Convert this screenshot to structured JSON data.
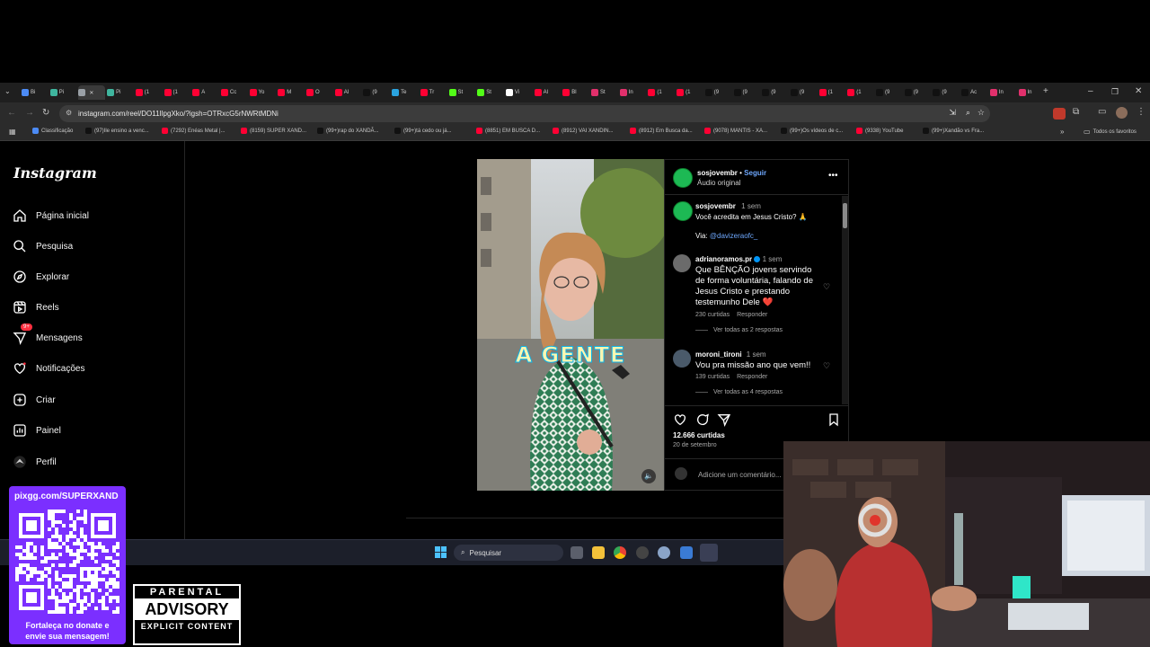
{
  "browser": {
    "url": "instagram.com/reel/DO11IlpgXko/?igsh=OTRxcG5rNWRtMDNi",
    "tabs": [
      {
        "label": "Bi",
        "color": "#4c8bf5"
      },
      {
        "label": "Pi",
        "color": "#3fb59e"
      },
      {
        "label": "",
        "color": "#9aa0a6"
      },
      {
        "label": "Pi",
        "color": "#3fb59e"
      },
      {
        "label": "(1",
        "color": "#ff0033"
      },
      {
        "label": "(1",
        "color": "#ff0033"
      },
      {
        "label": "A",
        "color": "#ff0033"
      },
      {
        "label": "Cc",
        "color": "#ff0033"
      },
      {
        "label": "Yo",
        "color": "#ff0033"
      },
      {
        "label": "M",
        "color": "#ff0033"
      },
      {
        "label": "O",
        "color": "#ff0033"
      },
      {
        "label": "Al",
        "color": "#ff0033"
      },
      {
        "label": "(9",
        "color": "#111111"
      },
      {
        "label": "Te",
        "color": "#2aa3df"
      },
      {
        "label": "Tr",
        "color": "#ff0033"
      },
      {
        "label": "St",
        "color": "#53fc18"
      },
      {
        "label": "St",
        "color": "#53fc18"
      },
      {
        "label": "Vi",
        "color": "#ffffff"
      },
      {
        "label": "Al",
        "color": "#ff0033"
      },
      {
        "label": "Bl",
        "color": "#ff0033"
      },
      {
        "label": "St",
        "color": "#e1306c"
      },
      {
        "label": "In",
        "color": "#e1306c"
      },
      {
        "label": "(1",
        "color": "#ff0033"
      },
      {
        "label": "(1",
        "color": "#ff0033"
      },
      {
        "label": "(9",
        "color": "#111111"
      },
      {
        "label": "(9",
        "color": "#111111"
      },
      {
        "label": "(9",
        "color": "#111111"
      },
      {
        "label": "(9",
        "color": "#111111"
      },
      {
        "label": "(1",
        "color": "#ff0033"
      },
      {
        "label": "(1",
        "color": "#ff0033"
      },
      {
        "label": "(9",
        "color": "#111111"
      },
      {
        "label": "(9",
        "color": "#111111"
      },
      {
        "label": "(9",
        "color": "#111111"
      },
      {
        "label": "Ac",
        "color": "#111111"
      },
      {
        "label": "In",
        "color": "#e1306c"
      },
      {
        "label": "In",
        "color": "#e1306c"
      }
    ],
    "bookmarks": [
      {
        "label": "Classificação",
        "color": "#4c8bf5"
      },
      {
        "label": "(97)Ile ensino a venc...",
        "color": "#111111"
      },
      {
        "label": "(7292) Enéas Metal |...",
        "color": "#ff0033"
      },
      {
        "label": "(8159) SUPER XAND...",
        "color": "#ff0033"
      },
      {
        "label": "(99+)rap do XANDÃ...",
        "color": "#111111"
      },
      {
        "label": "(99+)tá cedo ou já...",
        "color": "#111111"
      },
      {
        "label": "(8851) EM BUSCA D...",
        "color": "#ff0033"
      },
      {
        "label": "(8912) VAI XANDIN...",
        "color": "#ff0033"
      },
      {
        "label": "(8912) Em Busca da...",
        "color": "#ff0033"
      },
      {
        "label": "(9078) MANTIS - XA...",
        "color": "#ff0033"
      },
      {
        "label": "(99+)Os vídeos de c...",
        "color": "#111111"
      },
      {
        "label": "(9338) YouTube",
        "color": "#ff0033"
      },
      {
        "label": "(99+)Xandão vs Fra...",
        "color": "#111111"
      }
    ],
    "all_bookmarks": "Todos os favoritos"
  },
  "sidebar": {
    "logo": "Instagram",
    "items": [
      {
        "label": "Página inicial",
        "icon": "home-icon"
      },
      {
        "label": "Pesquisa",
        "icon": "search-icon"
      },
      {
        "label": "Explorar",
        "icon": "compass-icon"
      },
      {
        "label": "Reels",
        "icon": "reels-icon"
      },
      {
        "label": "Mensagens",
        "icon": "messenger-icon",
        "badge": "9+"
      },
      {
        "label": "Notificações",
        "icon": "heart-icon"
      },
      {
        "label": "Criar",
        "icon": "plus-icon"
      },
      {
        "label": "Painel",
        "icon": "dashboard-icon"
      },
      {
        "label": "Perfil",
        "icon": "profile-icon"
      }
    ]
  },
  "video": {
    "caption_overlay": "A GENTE"
  },
  "post": {
    "username": "sosjovembr",
    "follow": "Seguir",
    "audio": "Áudio original",
    "caption": {
      "user": "sosjovembr",
      "time": "1 sem",
      "text": "Você acredita em Jesus Cristo? 🙏",
      "via_prefix": "Via: ",
      "via_handle": "@davizeraofc_"
    },
    "comments": [
      {
        "user": "adrianoramos.pr",
        "time": "1 sem",
        "text": "Que BÊNÇÃO jovens servindo de forma voluntária, falando de Jesus Cristo e prestando testemunho Dele ❤️",
        "likes": "230 curtidas",
        "reply": "Responder",
        "view_replies": "Ver todas as 2 respostas"
      },
      {
        "user": "moroni_tironi",
        "time": "1 sem",
        "text": "Vou pra missão ano que vem!!",
        "likes": "139 curtidas",
        "reply": "Responder",
        "view_replies": "Ver todas as 4 respostas"
      }
    ],
    "likes": "12.666 curtidas",
    "date": "20 de setembro",
    "comment_placeholder": "Adicione um comentário..."
  },
  "taskbar": {
    "search": "Pesquisar"
  },
  "overlay": {
    "qr_url": "pixgg.com/SUPERXAND",
    "qr_caption_1": "Fortaleça no donate e",
    "qr_caption_2": "envie sua mensagem!",
    "advisory_top": "PARENTAL",
    "advisory_mid": "ADVISORY",
    "advisory_bottom": "EXPLICIT CONTENT"
  },
  "colors": {
    "instagram_blue": "#0095f6",
    "pix_purple": "#7b2fff",
    "badge_red": "#ff3040"
  }
}
